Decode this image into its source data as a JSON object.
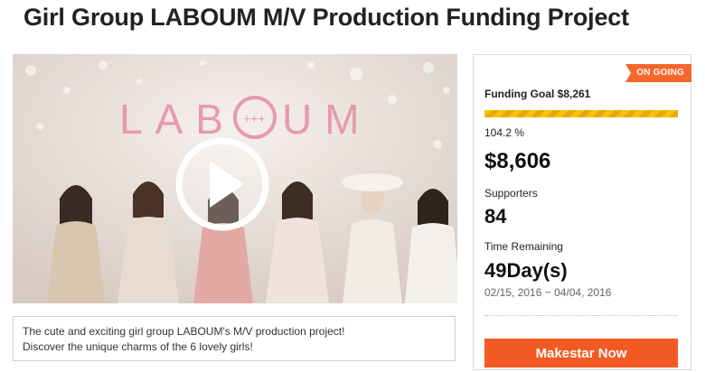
{
  "page": {
    "title": "Girl Group LABOUM M/V Production Funding Project"
  },
  "video": {
    "logo_text": "LAB",
    "logo_text_end": "UM",
    "logo_symbol": "+++"
  },
  "description": {
    "line1": "The cute and exciting girl group LABOUM's M/V production project!",
    "line2": "Discover the unique charms of the 6 lovely girls!"
  },
  "funding": {
    "status_badge": "ON GOING",
    "goal_label": "Funding Goal $8,261",
    "progress_fraction": 1.0,
    "percent_text": "104.2 %",
    "amount": "$8,606",
    "supporters_label": "Supporters",
    "supporters_count": "84",
    "time_label": "Time Remaining",
    "time_value": "49Day(s)",
    "date_range": "02/15, 2016 ~ 04/04, 2016",
    "cta_label": "Makestar Now"
  },
  "colors": {
    "accent": "#f15a22",
    "progress": "#f5c400",
    "logo_pink": "#e79aac"
  }
}
